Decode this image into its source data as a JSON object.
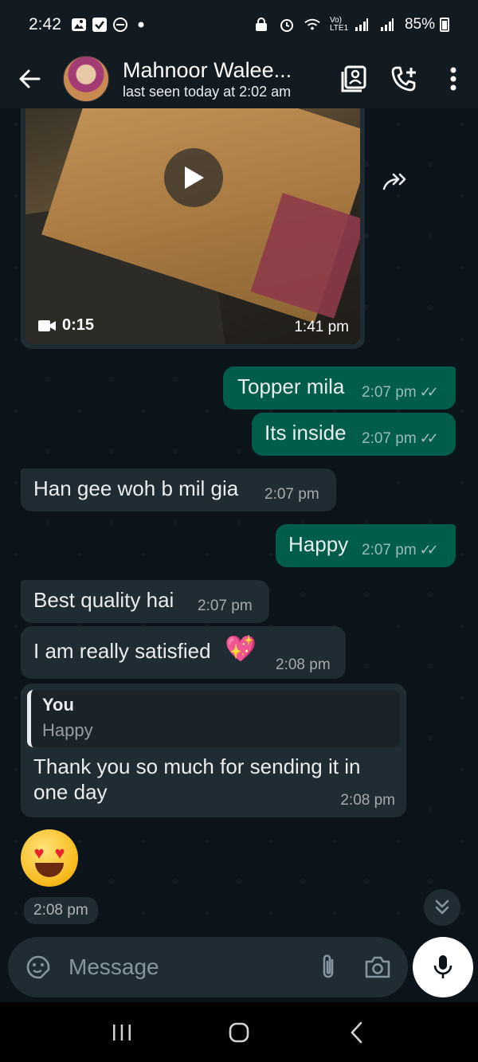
{
  "status_bar": {
    "time": "2:42",
    "battery": "85%",
    "network": "Vo) LTE1"
  },
  "header": {
    "contact_name": "Mahnoor Walee...",
    "last_seen": "last seen today at 2:02 am"
  },
  "video_message": {
    "duration": "0:15",
    "time": "1:41 pm"
  },
  "messages": [
    {
      "direction": "out",
      "text": "Topper mila",
      "time": "2:07 pm",
      "status": "read"
    },
    {
      "direction": "out",
      "text": "Its inside",
      "time": "2:07 pm",
      "status": "read"
    },
    {
      "direction": "in",
      "text": "Han gee woh b mil gia",
      "time": "2:07 pm"
    },
    {
      "direction": "out",
      "text": "Happy",
      "time": "2:07 pm",
      "status": "read"
    },
    {
      "direction": "in",
      "text": "Best quality hai",
      "time": "2:07 pm"
    },
    {
      "direction": "in",
      "text": "I am really satisfied",
      "emoji": "💖",
      "time": "2:08 pm"
    },
    {
      "direction": "in",
      "reply_to": {
        "author": "You",
        "text": "Happy"
      },
      "text_line1": "Thank you so much for sending it in",
      "text_line2": "one day",
      "time": "2:08 pm"
    },
    {
      "direction": "in",
      "emoji": "😍",
      "time": "2:08 pm"
    }
  ],
  "composer": {
    "placeholder": "Message"
  },
  "colors": {
    "background": "#0b141a",
    "header": "#111b21",
    "incoming_bubble": "#202c33",
    "outgoing_bubble": "#005c4b",
    "read_ticks": "#e9edef"
  }
}
